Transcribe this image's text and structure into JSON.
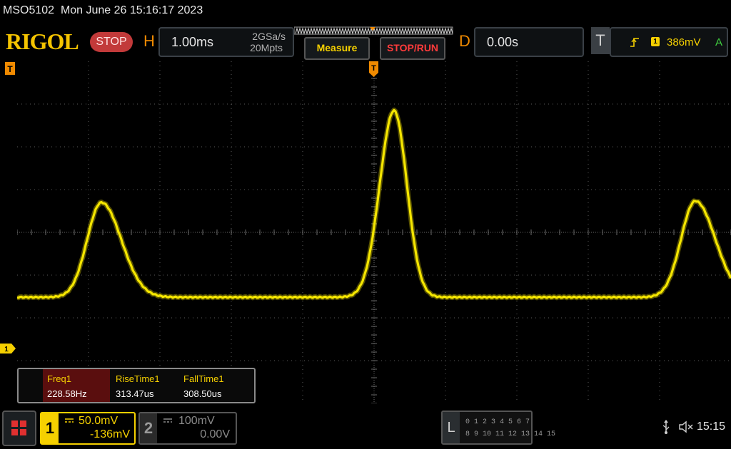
{
  "title_bar": {
    "model": "MSO5102",
    "datetime": "Mon June 26 15:16:17 2023"
  },
  "header": {
    "logo": "RIGOL",
    "run_state": "STOP",
    "horizontal": {
      "letter": "H",
      "timebase": "1.00ms",
      "sample_rate": "2GSa/s",
      "memory_depth": "20Mpts"
    },
    "measure_button": "Measure",
    "stop_run_button": "STOP/RUN",
    "delay": {
      "letter": "D",
      "value": "0.00s"
    },
    "trigger": {
      "letter": "T",
      "source": "1",
      "level": "386mV",
      "mode": "A",
      "edge_icon": "rising-edge-icon"
    }
  },
  "screen": {
    "trigger_marker_label": "T",
    "channel_marker_label": "1",
    "trace_color": "#f5e600"
  },
  "measurements": [
    {
      "label": "Freq1",
      "value": "228.58Hz",
      "selected": true
    },
    {
      "label": "RiseTime1",
      "value": "313.47us",
      "selected": false
    },
    {
      "label": "FallTime1",
      "value": "308.50us",
      "selected": false
    }
  ],
  "channels": {
    "ch1": {
      "number": "1",
      "scale": "50.0mV",
      "offset": "-136mV",
      "coupling_icon": "dc-coupling-icon",
      "color": "#f5d000"
    },
    "ch2": {
      "number": "2",
      "scale": "100mV",
      "offset": "0.00V",
      "coupling_icon": "dc-coupling-icon",
      "color": "#8a8a8a"
    }
  },
  "logic": {
    "letter": "L",
    "row1": "0 1 2 3   4 5 6 7",
    "row2": "8 9 10 11 12 13 14 15"
  },
  "status": {
    "usb_icon": "usb-icon",
    "speaker_icon": "speaker-muted-icon",
    "time": "15:15"
  },
  "colors": {
    "accent_orange": "#f08a00",
    "accent_yellow": "#f5d000",
    "stop_red": "#c23a3a",
    "grid": "#6a6a6a"
  }
}
